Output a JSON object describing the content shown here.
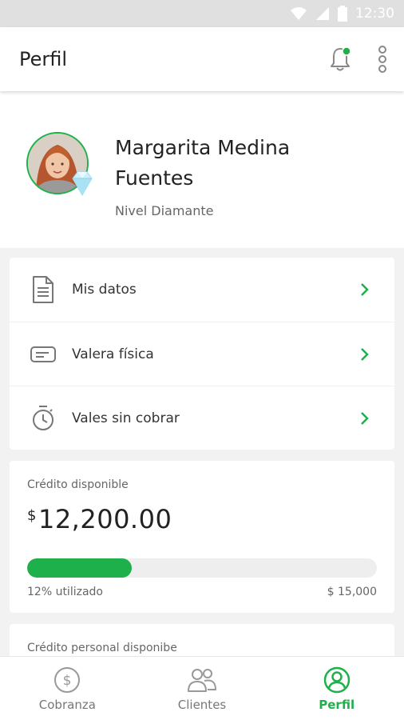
{
  "status_bar": {
    "time": "12:30"
  },
  "app_bar": {
    "title": "Perfil",
    "notification_dot_color": "#1db04b"
  },
  "profile": {
    "name": "Margarita Medina Fuentes",
    "level": "Nivel Diamante",
    "avatar_icon": "user-photo",
    "badge_icon": "diamond-icon"
  },
  "menu": {
    "items": [
      {
        "label": "Mis datos",
        "icon": "document-icon"
      },
      {
        "label": "Valera física",
        "icon": "ticket-icon"
      },
      {
        "label": "Vales sin cobrar",
        "icon": "timer-icon"
      }
    ]
  },
  "credit": {
    "caption": "Crédito disponible",
    "currency": "$",
    "amount": "12,200.00",
    "used_label": "12% utilizado",
    "used_fraction": 0.3,
    "limit": "$ 15,000"
  },
  "personal_credit": {
    "caption": "Crédito personal disponibe"
  },
  "bottom_nav": {
    "items": [
      {
        "label": "Cobranza",
        "icon": "dollar-coin-icon",
        "active": false
      },
      {
        "label": "Clientes",
        "icon": "users-icon",
        "active": false
      },
      {
        "label": "Perfil",
        "icon": "profile-icon",
        "active": true
      }
    ]
  },
  "colors": {
    "accent": "#1db04b",
    "text": "#222222",
    "muted": "#666666"
  }
}
